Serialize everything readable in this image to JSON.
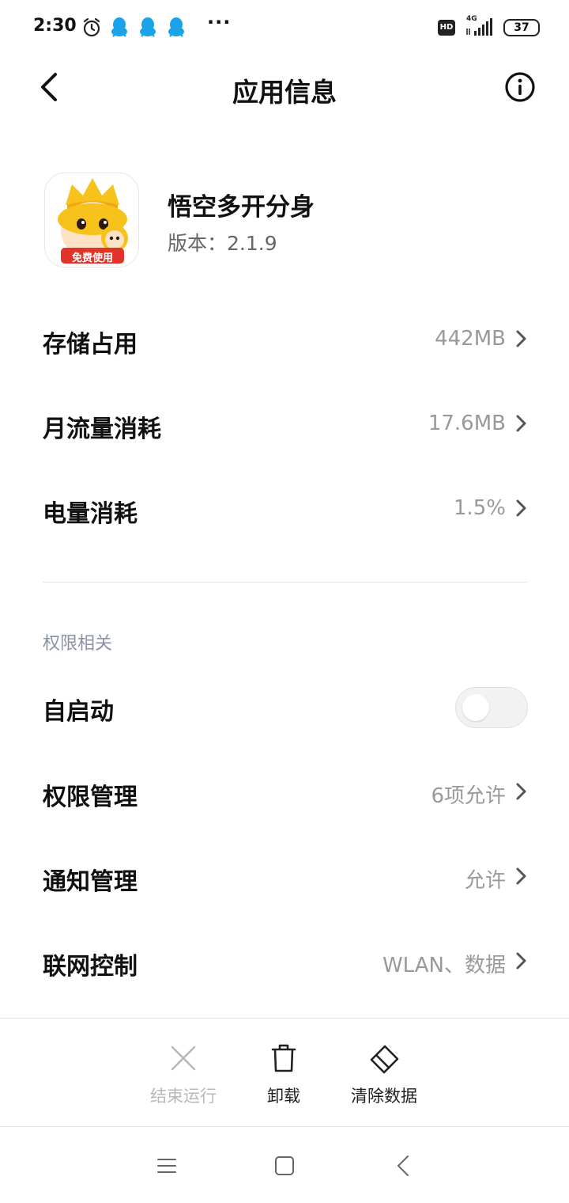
{
  "status_bar": {
    "time": "2:30",
    "more": "···",
    "network_badge": "HD",
    "network_type": "4G",
    "battery": "37"
  },
  "header": {
    "title": "应用信息"
  },
  "app": {
    "name": "悟空多开分身",
    "version": "版本：2.1.9",
    "icon_badge_text": "免费使用"
  },
  "usage_rows": [
    {
      "label": "存储占用",
      "value": "442MB"
    },
    {
      "label": "月流量消耗",
      "value": "17.6MB"
    },
    {
      "label": "电量消耗",
      "value": "1.5%"
    }
  ],
  "permissions": {
    "section_title": "权限相关",
    "autostart": {
      "label": "自启动",
      "enabled": false
    },
    "rows": [
      {
        "label": "权限管理",
        "value": "6项允许"
      },
      {
        "label": "通知管理",
        "value": "允许"
      },
      {
        "label": "联网控制",
        "value": "WLAN、数据"
      }
    ]
  },
  "actions": [
    {
      "label": "结束运行",
      "icon": "close-icon",
      "enabled": false
    },
    {
      "label": "卸载",
      "icon": "trash-icon",
      "enabled": true
    },
    {
      "label": "清除数据",
      "icon": "eraser-icon",
      "enabled": true
    }
  ],
  "colors": {
    "value_text": "#999999",
    "section_title": "#8a93a6",
    "disabled": "#b8b8b8"
  }
}
